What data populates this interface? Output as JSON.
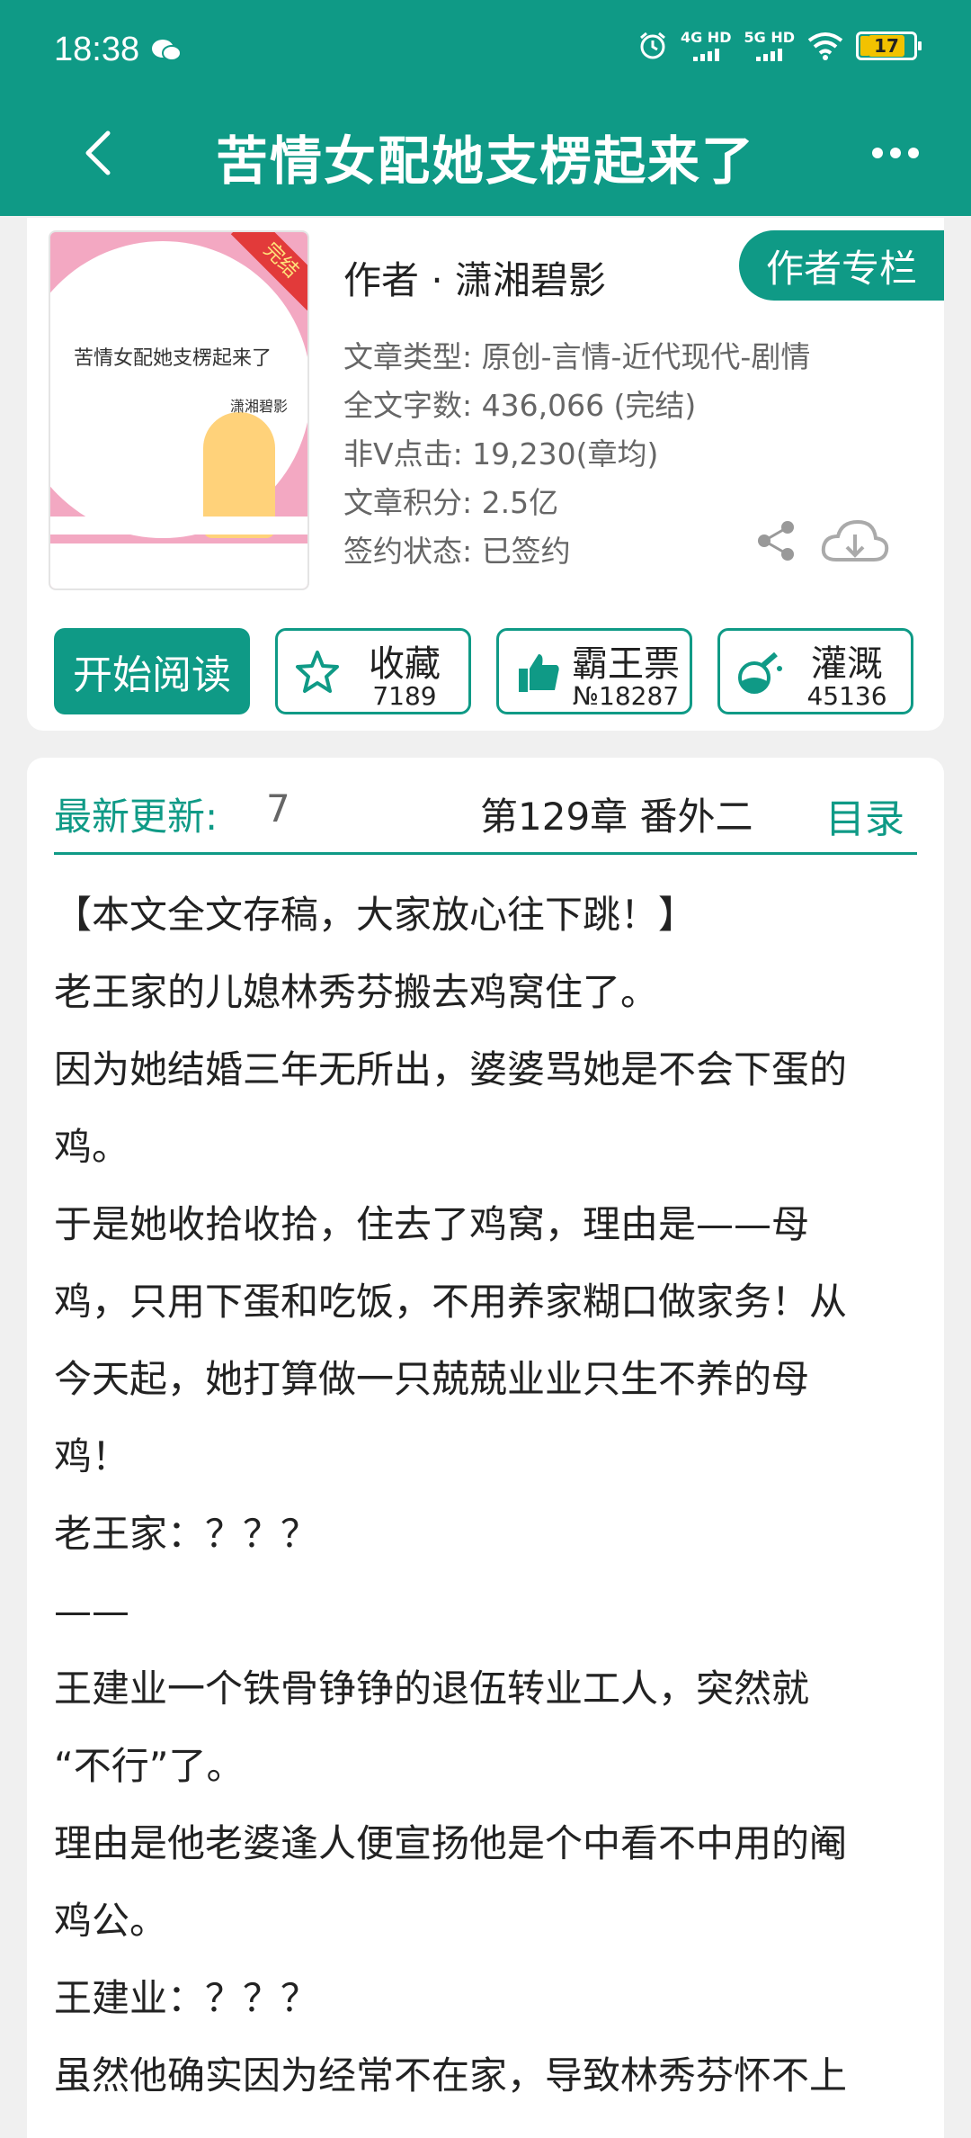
{
  "status": {
    "time": "18:38",
    "net1": "4G HD",
    "net2": "5G HD",
    "battery": "17"
  },
  "nav": {
    "title": "苦情女配她支楞起来了"
  },
  "cover": {
    "title": "苦情女配她支楞起来了",
    "author": "潇湘碧影",
    "badge": "完结"
  },
  "book": {
    "author_line": "作者 · 潇湘碧影",
    "column_button": "作者专栏",
    "info": [
      "文章类型: 原创-言情-近代现代-剧情",
      "全文字数: 436,066 (完结)",
      "非Ⅴ点击: 19,230(章均)",
      "文章积分: 2.5亿",
      "签约状态: 已签约"
    ]
  },
  "actions": {
    "read": "开始阅读",
    "collect": {
      "label": "收藏",
      "count": "7189"
    },
    "ticket": {
      "label": "霸王票",
      "count": "№18287"
    },
    "irrigate": {
      "label": "灌溉",
      "count": "45136"
    }
  },
  "update": {
    "label": "最新更新:",
    "date": "7",
    "chapter": "第129章  番外二",
    "toc": "目录"
  },
  "intro": [
    "【本文全文存稿，大家放心往下跳！】",
    "老王家的儿媳林秀芬搬去鸡窝住了。",
    "因为她结婚三年无所出，婆婆骂她是不会下蛋的",
    "鸡。",
    "于是她收拾收拾，住去了鸡窝，理由是——母",
    "鸡，只用下蛋和吃饭，不用养家糊口做家务！从",
    "今天起，她打算做一只兢兢业业只生不养的母",
    "鸡！",
    "老王家：？？？",
    "——",
    "王建业一个铁骨铮铮的退伍转业工人，突然就",
    "“不行”了。",
    "理由是他老婆逢人便宣扬他是个中看不中用的阉",
    "鸡公。",
    "王建业：？？？",
    "虽然他确实因为经常不在家，导致林秀芬怀不上"
  ]
}
